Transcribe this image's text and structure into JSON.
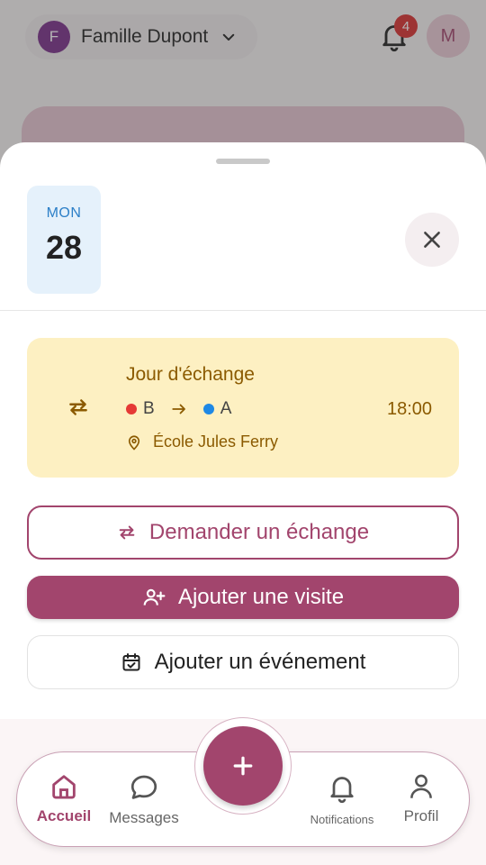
{
  "header": {
    "family_initial": "F",
    "family_name": "Famille Dupont",
    "notification_count": "4",
    "user_initial": "M"
  },
  "day_sheet": {
    "weekday": "MON",
    "day_number": "28"
  },
  "event": {
    "title": "Jour d'échange",
    "from_parent": "B",
    "from_color": "#e53935",
    "to_parent": "A",
    "to_color": "#1e88e5",
    "time": "18:00",
    "location": "École Jules Ferry"
  },
  "actions": {
    "request_swap": "Demander un échange",
    "add_visit": "Ajouter une visite",
    "add_event": "Ajouter un événement"
  },
  "nav": {
    "home": "Accueil",
    "messages": "Messages",
    "notifications": "Notifications",
    "profile": "Profil"
  },
  "colors": {
    "primary": "#a2456d",
    "event_bg": "#fdf0c2",
    "event_text": "#8b5a00",
    "date_bg": "#e5f1fb"
  }
}
